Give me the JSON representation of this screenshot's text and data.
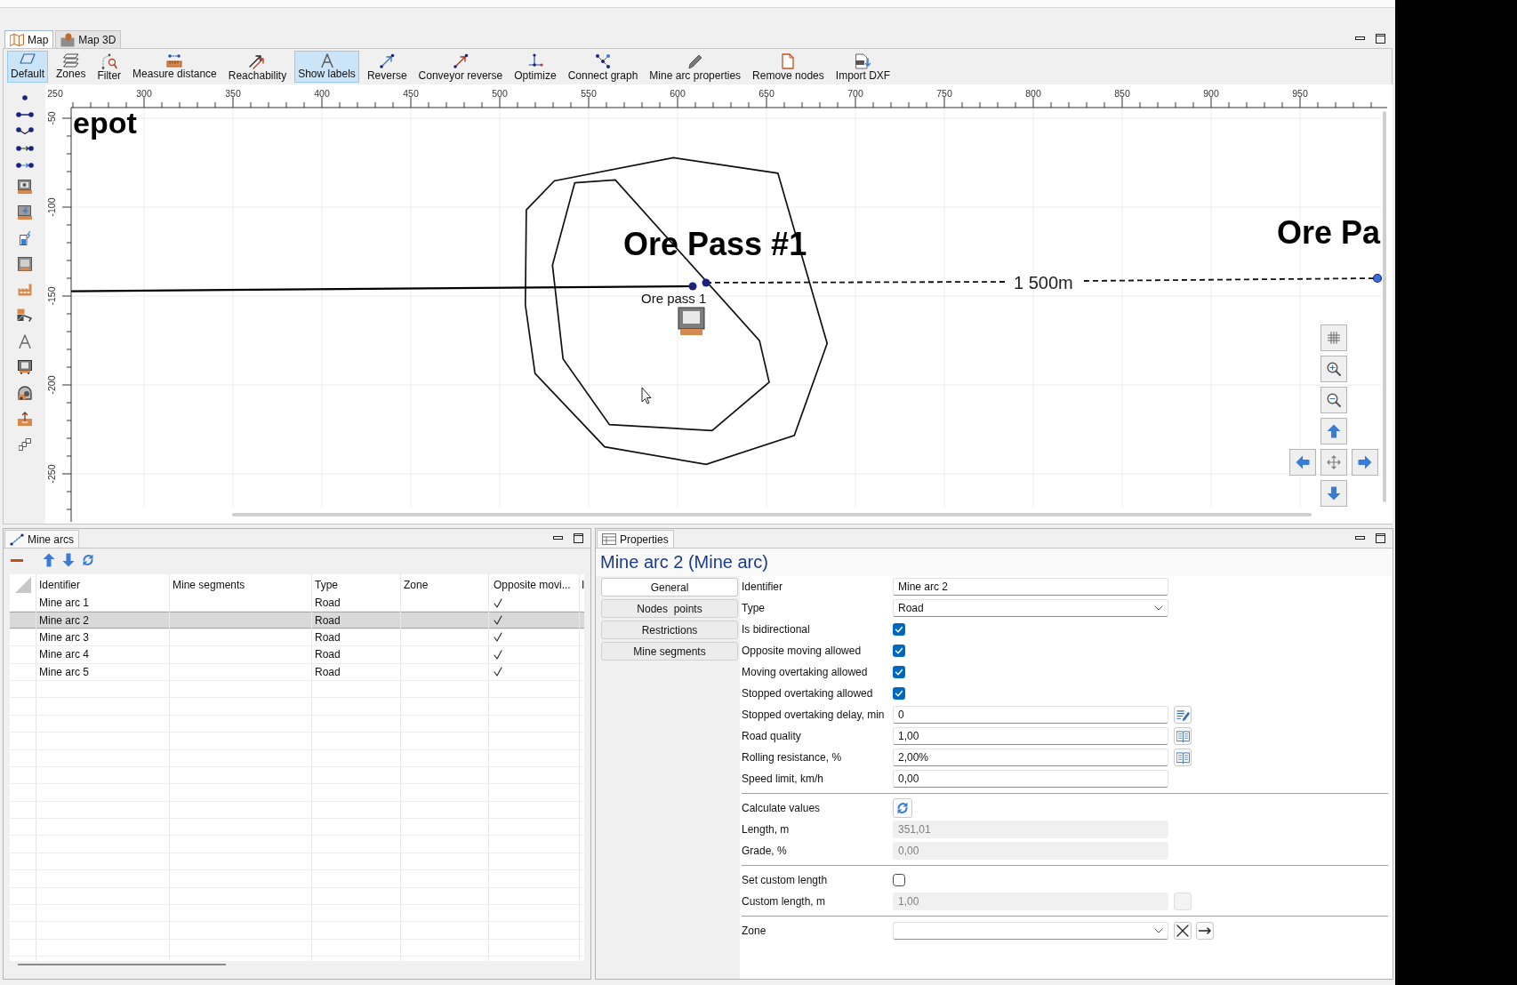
{
  "map_panel": {
    "tabs": [
      {
        "label": "Map",
        "selected": true
      },
      {
        "label": "Map 3D",
        "selected": false
      }
    ],
    "toolbar": [
      {
        "label": "Default",
        "selected": true
      },
      {
        "label": "Zones",
        "selected": false
      },
      {
        "label": "Filter",
        "selected": false
      },
      {
        "label": "Measure distance",
        "selected": false
      },
      {
        "label": "Reachability",
        "selected": false
      },
      {
        "label": "Show labels",
        "selected": true
      },
      {
        "label": "Reverse",
        "selected": false
      },
      {
        "label": "Conveyor reverse",
        "selected": false
      },
      {
        "label": "Optimize",
        "selected": false
      },
      {
        "label": "Connect graph",
        "selected": false
      },
      {
        "label": "Mine arc properties",
        "selected": false
      },
      {
        "label": "Remove nodes",
        "selected": false
      },
      {
        "label": "Import DXF",
        "selected": false
      }
    ],
    "map": {
      "x_ruler": [
        "250",
        "300",
        "350",
        "400",
        "450",
        "500",
        "550",
        "600",
        "650",
        "700",
        "750",
        "800",
        "850",
        "900",
        "950"
      ],
      "y_ruler": [
        "-50",
        "-100",
        "-150",
        "-200",
        "-250"
      ],
      "labels": [
        {
          "kind": "title",
          "text": "epot"
        },
        {
          "kind": "title",
          "text": "Ore Pass #1"
        },
        {
          "kind": "title",
          "text": "Ore Pa"
        },
        {
          "kind": "distance",
          "text": "1 500m"
        },
        {
          "kind": "name",
          "text": "Ore pass 1"
        }
      ]
    }
  },
  "mine_arcs_panel": {
    "tab": "Mine arcs",
    "table": {
      "columns": [
        "Identifier",
        "Mine segments",
        "Type",
        "Zone",
        "Opposite movi...",
        "I"
      ],
      "rows": [
        {
          "identifier": "Mine arc 1",
          "type": "Road",
          "opposite_moving": true,
          "selected": false
        },
        {
          "identifier": "Mine arc 2",
          "type": "Road",
          "opposite_moving": true,
          "selected": true
        },
        {
          "identifier": "Mine arc 3",
          "type": "Road",
          "opposite_moving": true,
          "selected": false
        },
        {
          "identifier": "Mine arc 4",
          "type": "Road",
          "opposite_moving": true,
          "selected": false
        },
        {
          "identifier": "Mine arc 5",
          "type": "Road",
          "opposite_moving": true,
          "selected": false
        }
      ]
    }
  },
  "properties_panel": {
    "tab": "Properties",
    "title": "Mine arc 2 (Mine arc)",
    "nav": [
      {
        "label": "General",
        "selected": true
      },
      {
        "label": "Nodes  points",
        "selected": false
      },
      {
        "label": "Restrictions",
        "selected": false
      },
      {
        "label": "Mine segments",
        "selected": false
      }
    ],
    "sections": [
      {
        "rows": [
          {
            "kind": "text",
            "label": "Identifier",
            "value": "Mine arc 2",
            "disabled": false
          },
          {
            "kind": "select",
            "label": "Type",
            "value": "Road",
            "disabled": false
          },
          {
            "kind": "checkbox",
            "label": "Is bidirectional",
            "checked": true
          },
          {
            "kind": "checkbox",
            "label": "Opposite moving allowed",
            "checked": true
          },
          {
            "kind": "checkbox",
            "label": "Moving overtaking allowed",
            "checked": true
          },
          {
            "kind": "checkbox",
            "label": "Stopped overtaking allowed",
            "checked": true
          },
          {
            "kind": "text",
            "label": "Stopped overtaking delay, min",
            "value": "0",
            "disabled": false,
            "buttons": [
              {
                "kind": "edit-list",
                "disabled": false
              }
            ]
          },
          {
            "kind": "text",
            "label": "Road quality",
            "value": "1,00",
            "disabled": false,
            "buttons": [
              {
                "kind": "book",
                "disabled": false
              }
            ]
          },
          {
            "kind": "text",
            "label": "Rolling resistance, %",
            "value": "2,00%",
            "disabled": false,
            "buttons": [
              {
                "kind": "book",
                "disabled": false
              }
            ]
          },
          {
            "kind": "text",
            "label": "Speed limit, km/h",
            "value": "0,00",
            "disabled": false
          }
        ]
      },
      {
        "rows": [
          {
            "kind": "action",
            "label": "Calculate values"
          },
          {
            "kind": "text",
            "label": "Length, m",
            "value": "351,01",
            "disabled": true
          },
          {
            "kind": "text",
            "label": "Grade, %",
            "value": "0,00",
            "disabled": true
          }
        ]
      },
      {
        "rows": [
          {
            "kind": "checkbox",
            "label": "Set custom length",
            "checked": false
          },
          {
            "kind": "text",
            "label": "Custom length, m",
            "value": "1,00",
            "disabled": true,
            "buttons": [
              {
                "kind": "blank",
                "disabled": true
              }
            ]
          }
        ]
      },
      {
        "rows": [
          {
            "kind": "select",
            "label": "Zone",
            "disabled": false,
            "buttons": [
              {
                "kind": "clear",
                "disabled": false
              },
              {
                "kind": "go",
                "disabled": false
              }
            ]
          }
        ]
      }
    ]
  }
}
